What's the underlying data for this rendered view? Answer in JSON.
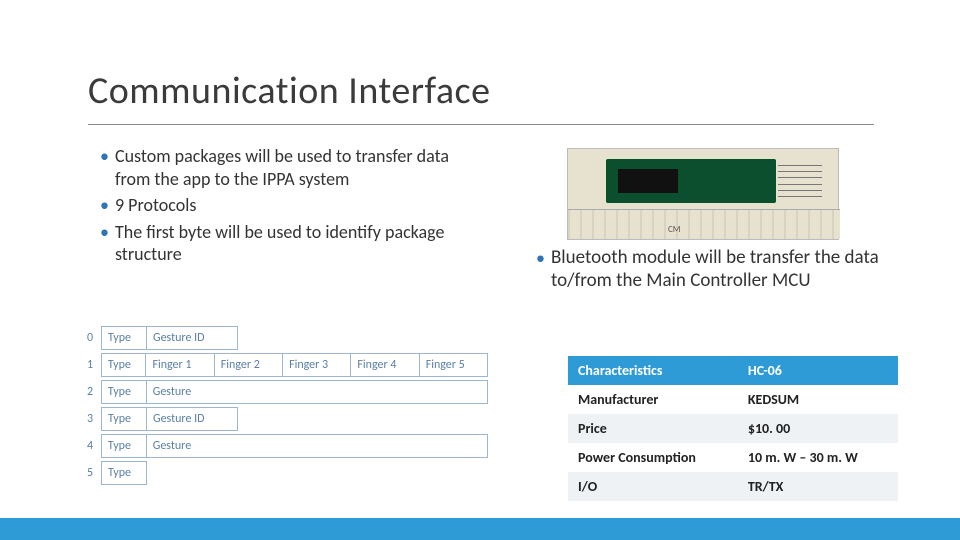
{
  "title": "Communication Interface",
  "left_bullets": [
    "Custom packages will be used to transfer data from the app to the IPPA system",
    "9 Protocols",
    "The first byte will be used to identify package structure"
  ],
  "right_bullet": "Bluetooth module will be transfer the data to/from the Main Controller MCU",
  "module_ruler_label": "CM",
  "protocol_rows": [
    {
      "idx": "0",
      "cells": [
        "Type",
        "Gesture ID"
      ]
    },
    {
      "idx": "1",
      "cells": [
        "Type",
        "Finger 1",
        "Finger 2",
        "Finger 3",
        "Finger 4",
        "Finger 5"
      ]
    },
    {
      "idx": "2",
      "cells": [
        "Type",
        "Gesture"
      ]
    },
    {
      "idx": "3",
      "cells": [
        "Type",
        "Gesture ID"
      ]
    },
    {
      "idx": "4",
      "cells": [
        "Type",
        "Gesture"
      ]
    },
    {
      "idx": "5",
      "cells": [
        "Type"
      ]
    }
  ],
  "char_table": {
    "header": [
      "Characteristics",
      "HC-06"
    ],
    "rows": [
      [
        "Manufacturer",
        "KEDSUM"
      ],
      [
        "Price",
        "$10. 00"
      ],
      [
        "Power Consumption",
        "10 m. W – 30 m. W"
      ],
      [
        "I/O",
        "TR/TX"
      ]
    ]
  }
}
